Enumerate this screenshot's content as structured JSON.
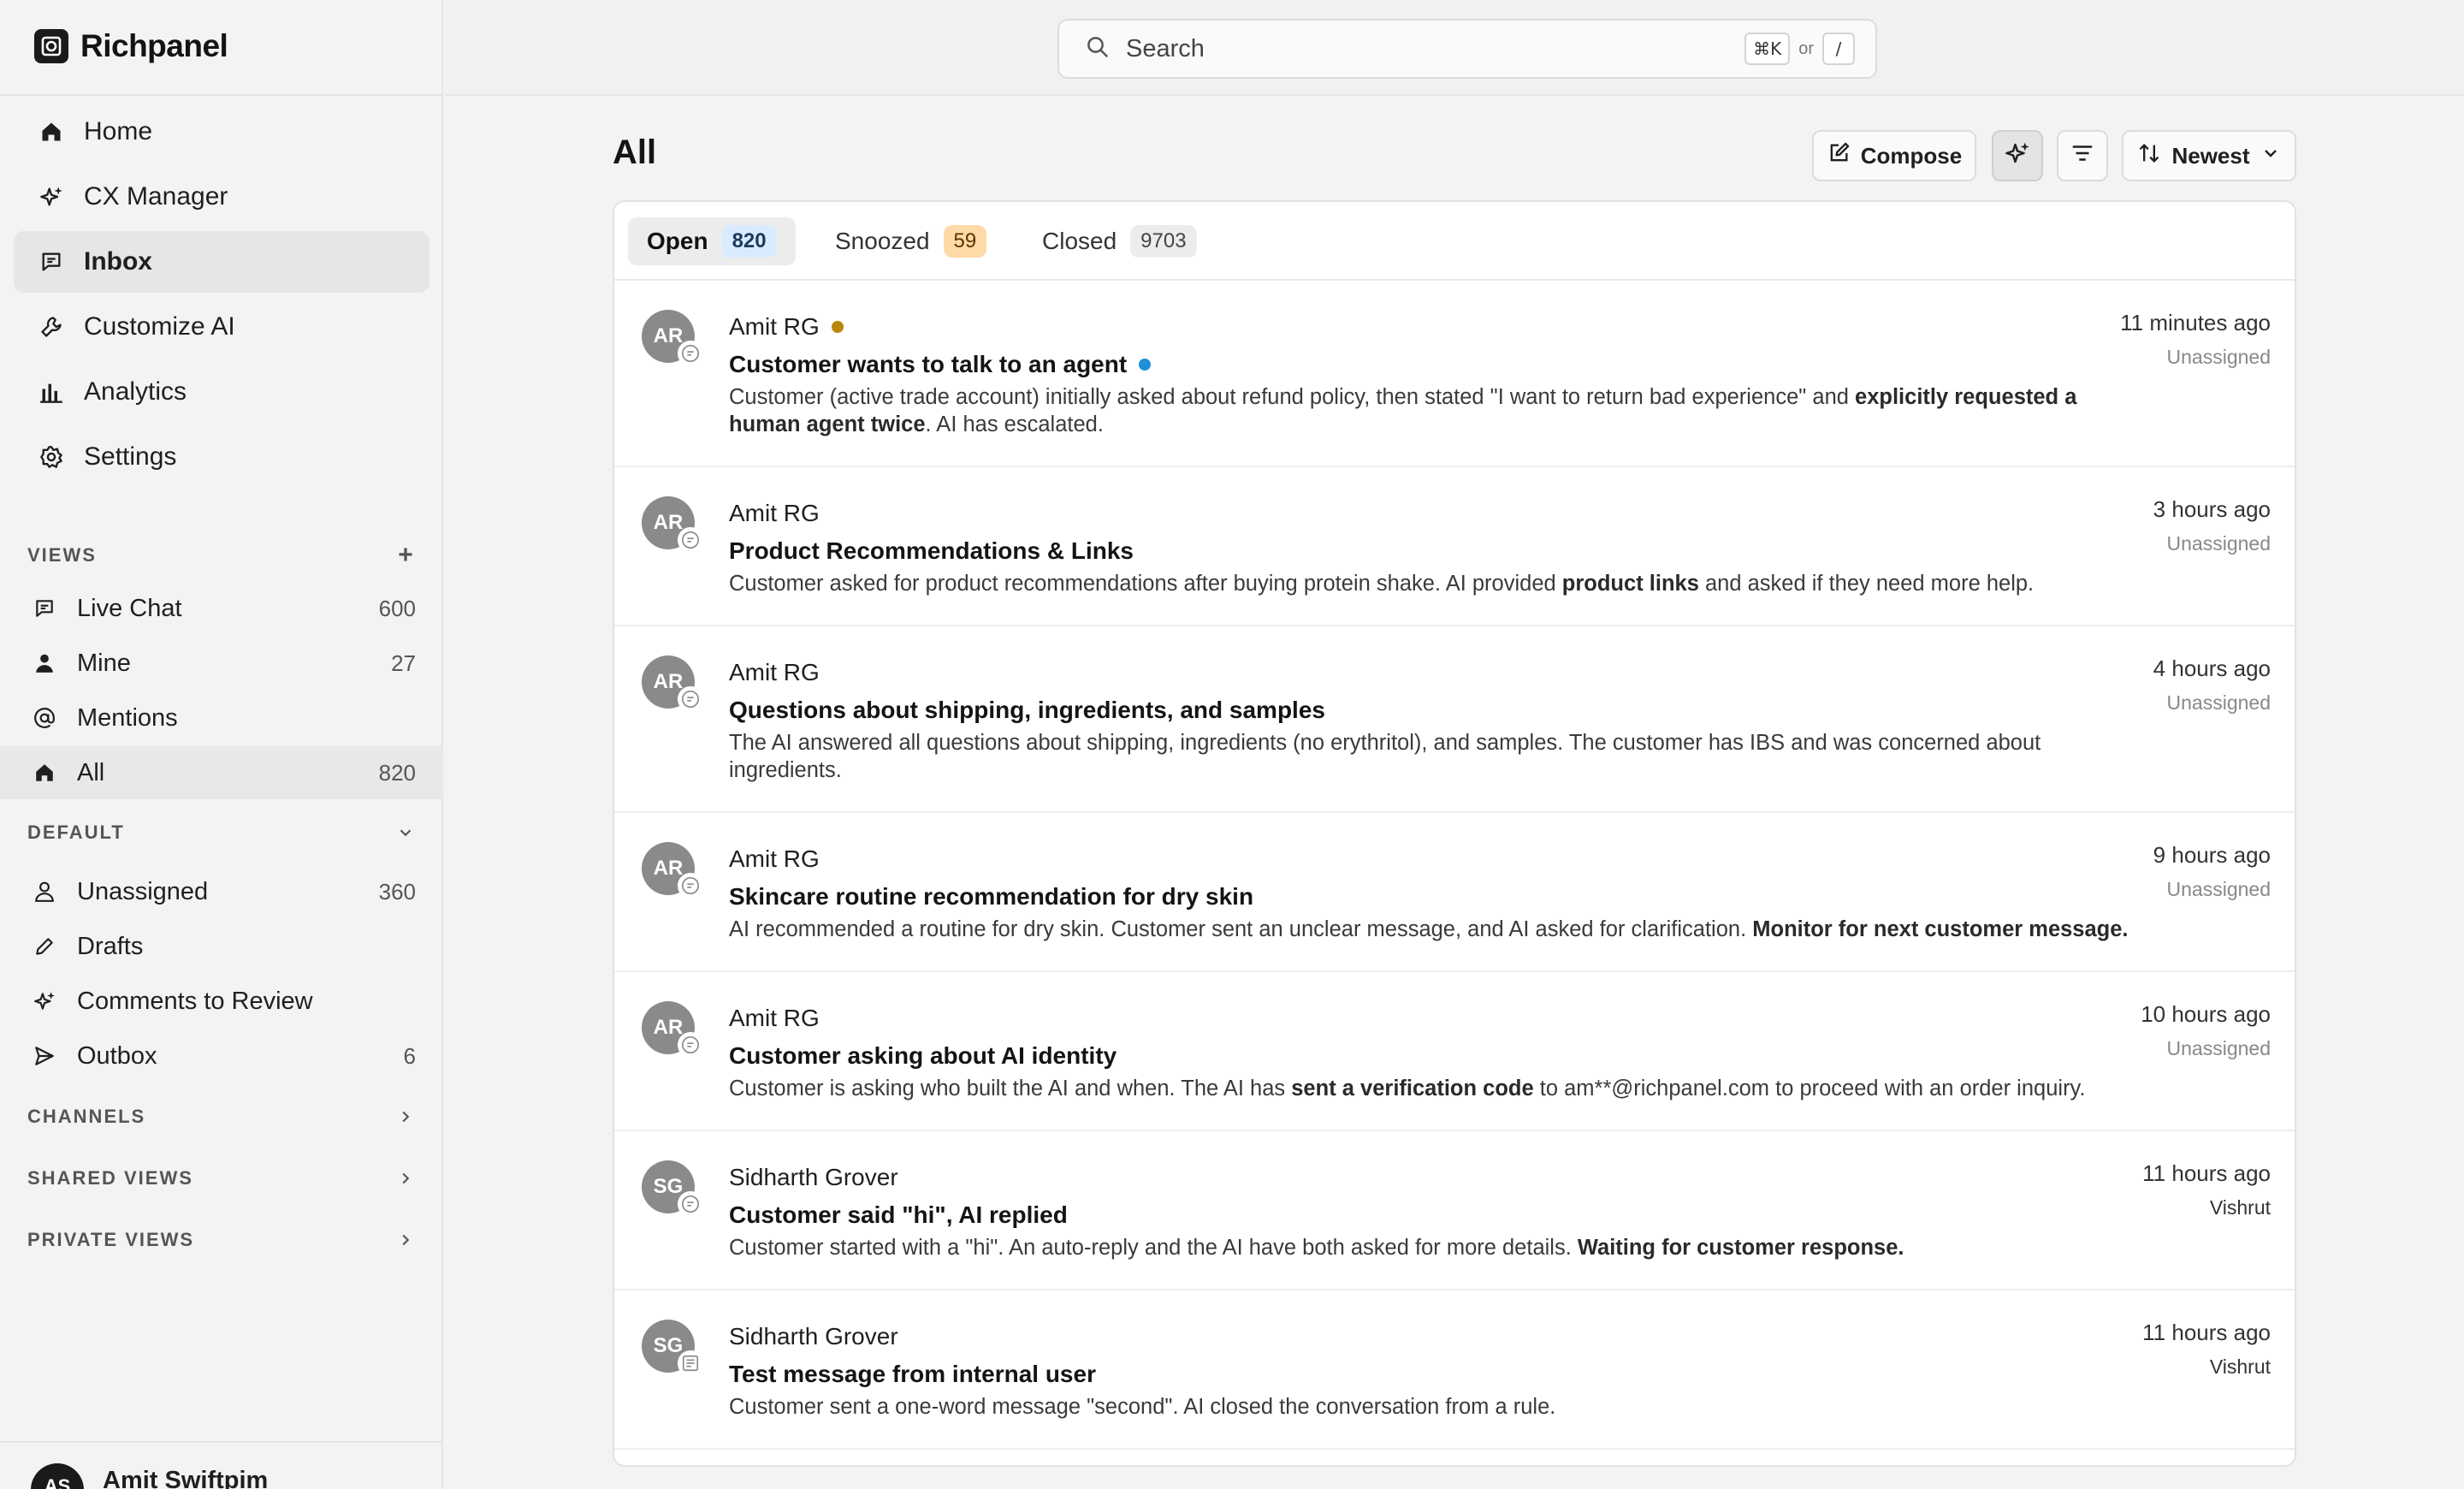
{
  "app": {
    "brand": "Richpanel"
  },
  "nav": {
    "items": [
      {
        "label": "Home",
        "icon": "home-icon"
      },
      {
        "label": "CX Manager",
        "icon": "sparkle-icon"
      },
      {
        "label": "Inbox",
        "icon": "chat-bubble-icon",
        "active": true
      },
      {
        "label": "Customize AI",
        "icon": "wrench-icon"
      },
      {
        "label": "Analytics",
        "icon": "bar-chart-icon"
      },
      {
        "label": "Settings",
        "icon": "gear-icon"
      }
    ]
  },
  "views": {
    "heading": "VIEWS",
    "items": [
      {
        "label": "Live Chat",
        "count": "600",
        "icon": "chat-bubble-icon"
      },
      {
        "label": "Mine",
        "count": "27",
        "icon": "person-icon"
      },
      {
        "label": "Mentions",
        "count": "",
        "icon": "at-icon"
      },
      {
        "label": "All",
        "count": "820",
        "icon": "home-icon",
        "active": true
      }
    ]
  },
  "default_section": {
    "heading": "DEFAULT",
    "items": [
      {
        "label": "Unassigned",
        "count": "360",
        "icon": "person-outline-icon"
      },
      {
        "label": "Drafts",
        "count": "",
        "icon": "pencil-icon"
      },
      {
        "label": "Comments to Review",
        "count": "",
        "icon": "sparkle-icon"
      },
      {
        "label": "Outbox",
        "count": "6",
        "icon": "send-icon"
      }
    ]
  },
  "collapsed_sections": [
    "CHANNELS",
    "SHARED VIEWS",
    "PRIVATE VIEWS"
  ],
  "user": {
    "initials": "AS",
    "name": "Amit Swiftpim"
  },
  "search": {
    "placeholder": "Search",
    "shortcut_1": "⌘K",
    "shortcut_or": "or",
    "shortcut_2": "/"
  },
  "page": {
    "title": "All"
  },
  "toolbar": {
    "compose_label": "Compose",
    "sort_label": "Newest"
  },
  "tabs": [
    {
      "label": "Open",
      "count": "820",
      "active": true
    },
    {
      "label": "Snoozed",
      "count": "59"
    },
    {
      "label": "Closed",
      "count": "9703"
    }
  ],
  "conversations": [
    {
      "initials": "AR",
      "sender": "Amit RG",
      "sender_dot": "#b8860b",
      "subject": "Customer wants to talk to an agent",
      "subject_dot": "#1e90d6",
      "summary_html": "Customer (active trade account) initially asked about refund policy, then stated \"I want to return bad experience\" and <b>explicitly requested a human agent twice</b>. AI has escalated.",
      "time": "11 minutes ago",
      "assignee": "Unassigned",
      "channel_icon": "chat-bubble-icon"
    },
    {
      "initials": "AR",
      "sender": "Amit RG",
      "subject": "Product Recommendations & Links",
      "summary_html": "Customer asked for product recommendations after buying protein shake. AI provided <b>product links</b> and asked if they need more help.",
      "time": "3 hours ago",
      "assignee": "Unassigned",
      "channel_icon": "chat-bubble-icon"
    },
    {
      "initials": "AR",
      "sender": "Amit RG",
      "subject": "Questions about shipping, ingredients, and samples",
      "summary_html": "The AI answered all questions about shipping, ingredients (no erythritol), and samples. The customer has IBS and was concerned about ingredients.",
      "time": "4 hours ago",
      "assignee": "Unassigned",
      "channel_icon": "chat-bubble-icon"
    },
    {
      "initials": "AR",
      "sender": "Amit RG",
      "subject": "Skincare routine recommendation for dry skin",
      "summary_html": "AI recommended a routine for dry skin. Customer sent an unclear message, and AI asked for clarification. <b>Monitor for next customer message.</b>",
      "time": "9 hours ago",
      "assignee": "Unassigned",
      "channel_icon": "chat-bubble-icon"
    },
    {
      "initials": "AR",
      "sender": "Amit RG",
      "subject": "Customer asking about AI identity",
      "summary_html": "Customer is asking who built the AI and when. The AI has <b>sent a verification code</b> to am**@richpanel.com to proceed with an order inquiry.",
      "time": "10 hours ago",
      "assignee": "Unassigned",
      "channel_icon": "chat-bubble-icon"
    },
    {
      "initials": "SG",
      "sender": "Sidharth Grover",
      "subject": "Customer said \"hi\", AI replied",
      "summary_html": "Customer started with a \"hi\". An auto-reply and the AI have both asked for more details. <b>Waiting for customer response.</b>",
      "time": "11 hours ago",
      "assignee": "Vishrut",
      "channel_icon": "chat-bubble-icon"
    },
    {
      "initials": "SG",
      "sender": "Sidharth Grover",
      "subject": "Test message from internal user",
      "summary_html": "Customer sent a one-word message \"second\". AI closed the conversation from a rule.",
      "time": "11 hours ago",
      "assignee": "Vishrut",
      "channel_icon": "form-icon"
    }
  ]
}
